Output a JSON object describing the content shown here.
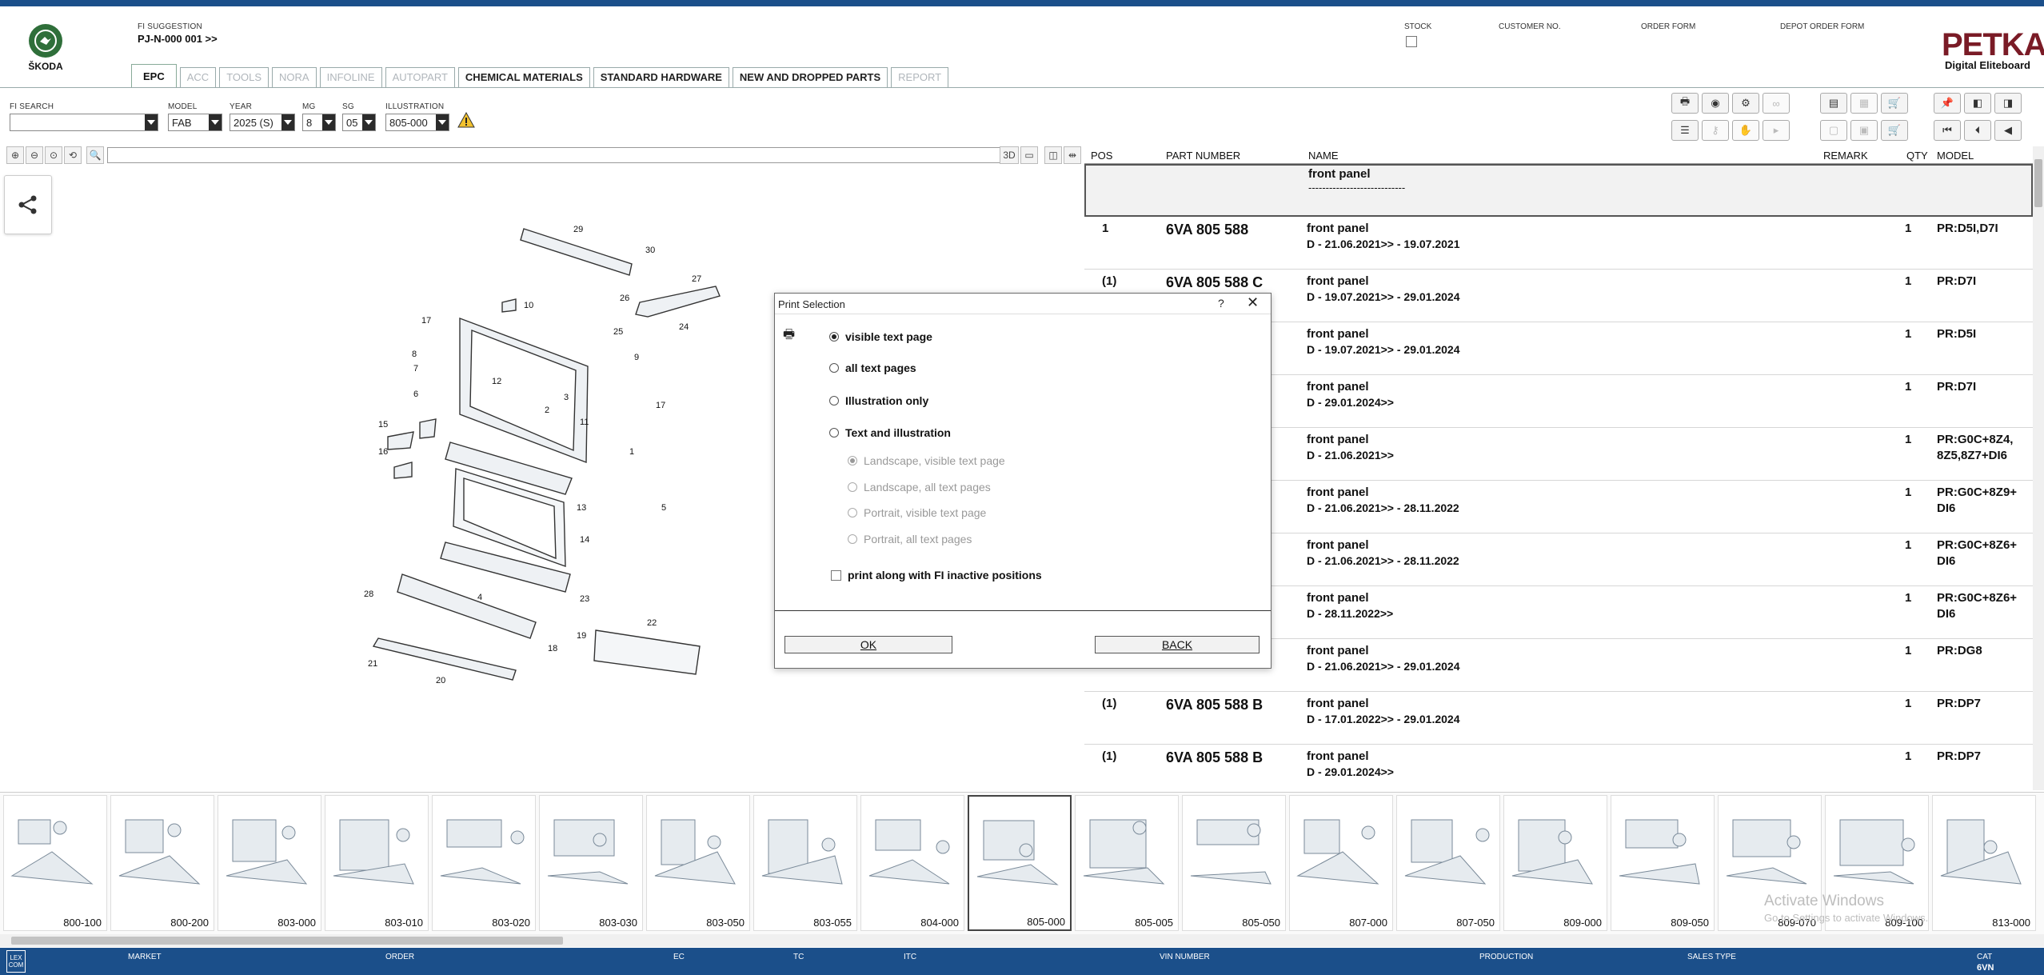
{
  "brand": {
    "logo_text": "ŠKODA",
    "petka_title": "PETKA",
    "petka_subtitle": "Digital Eliteboard"
  },
  "fi_suggestion": {
    "label": "FI SUGGESTION",
    "value": "PJ-N-000 001 >>"
  },
  "top_fields": {
    "stock": "STOCK",
    "customer_no": "CUSTOMER NO.",
    "order_form": "ORDER FORM",
    "depot_order_form": "DEPOT ORDER FORM"
  },
  "tabs": [
    {
      "label": "EPC",
      "state": "active"
    },
    {
      "label": "ACC",
      "state": "disabled"
    },
    {
      "label": "TOOLS",
      "state": "disabled"
    },
    {
      "label": "NORA",
      "state": "disabled"
    },
    {
      "label": "INFOLINE",
      "state": "disabled"
    },
    {
      "label": "AUTOPART",
      "state": "disabled"
    },
    {
      "label": "CHEMICAL MATERIALS",
      "state": "enabled"
    },
    {
      "label": "STANDARD HARDWARE",
      "state": "enabled"
    },
    {
      "label": "NEW AND DROPPED PARTS",
      "state": "enabled"
    },
    {
      "label": "REPORT",
      "state": "disabled"
    }
  ],
  "filters": {
    "fi_search": {
      "label": "FI SEARCH",
      "value": ""
    },
    "model": {
      "label": "MODEL",
      "value": "FAB"
    },
    "year": {
      "label": "YEAR",
      "value": "2025 (S)"
    },
    "mg": {
      "label": "MG",
      "value": "8"
    },
    "sg": {
      "label": "SG",
      "value": "05"
    },
    "illustration": {
      "label": "ILLUSTRATION",
      "value": "805-000"
    }
  },
  "table": {
    "headers": {
      "pos": "POS",
      "part_number": "PART NUMBER",
      "name": "NAME",
      "remark": "REMARK",
      "qty": "QTY",
      "model": "MODEL"
    },
    "group_header": {
      "name": "front panel",
      "sub": "----------------------------"
    },
    "rows": [
      {
        "pos": "1",
        "part": "6VA 805 588",
        "name": "front panel",
        "date": "D - 21.06.2021>> - 19.07.2021",
        "qty": "1",
        "model": "PR:D5I,D7I",
        "model2": ""
      },
      {
        "pos": "(1)",
        "part": "6VA 805 588 C",
        "name": "front panel",
        "date": "D - 19.07.2021>> - 29.01.2024",
        "qty": "1",
        "model": "PR:D7I",
        "model2": ""
      },
      {
        "pos": "",
        "part": "",
        "name": "front panel",
        "date": "D - 19.07.2021>> - 29.01.2024",
        "qty": "1",
        "model": "PR:D5I",
        "model2": ""
      },
      {
        "pos": "",
        "part": "",
        "name": "front panel",
        "date": "D - 29.01.2024>>",
        "qty": "1",
        "model": "PR:D7I",
        "model2": ""
      },
      {
        "pos": "",
        "part": "",
        "name": "front panel",
        "date": "D - 21.06.2021>>",
        "qty": "1",
        "model": "PR:G0C+8Z4,",
        "model2": "8Z5,8Z7+DI6"
      },
      {
        "pos": "",
        "part": "",
        "name": "front panel",
        "date": "D - 21.06.2021>> - 28.11.2022",
        "qty": "1",
        "model": "PR:G0C+8Z9+",
        "model2": "DI6"
      },
      {
        "pos": "",
        "part": "",
        "name": "front panel",
        "date": "D - 21.06.2021>> - 28.11.2022",
        "qty": "1",
        "model": "PR:G0C+8Z6+",
        "model2": "DI6"
      },
      {
        "pos": "",
        "part": "",
        "name": "front panel",
        "date": "D - 28.11.2022>>",
        "qty": "1",
        "model": "PR:G0C+8Z6+",
        "model2": "DI6"
      },
      {
        "pos": "",
        "part": "",
        "name": "front panel",
        "date": "D - 21.06.2021>> - 29.01.2024",
        "qty": "1",
        "model": "PR:DG8",
        "model2": ""
      },
      {
        "pos": "(1)",
        "part": "6VA 805 588 B",
        "name": "front panel",
        "date": "D - 17.01.2022>> - 29.01.2024",
        "qty": "1",
        "model": "PR:DP7",
        "model2": ""
      },
      {
        "pos": "(1)",
        "part": "6VA 805 588 B",
        "name": "front panel",
        "date": "D - 29.01.2024>>",
        "qty": "1",
        "model": "PR:DP7",
        "model2": ""
      }
    ]
  },
  "dialog": {
    "title": "Print Selection",
    "help": "?",
    "close": "✕",
    "options": {
      "visible_text_page": "visible text page",
      "all_text_pages": "all text pages",
      "illustration_only": "Illustration only",
      "text_and_illustration": "Text and illustration"
    },
    "sub_options": {
      "landscape_visible": "Landscape, visible text page",
      "landscape_all": "Landscape, all text pages",
      "portrait_visible": "Portrait, visible text page",
      "portrait_all": "Portrait, all text pages"
    },
    "checkbox_label": "print along with FI inactive positions",
    "ok": "OK",
    "back": "BACK"
  },
  "illustration_callouts": [
    "29",
    "30",
    "27",
    "26",
    "24",
    "25",
    "10",
    "17",
    "9",
    "8",
    "7",
    "12",
    "3",
    "2",
    "17",
    "6",
    "11",
    "15",
    "1",
    "16",
    "13",
    "5",
    "14",
    "28",
    "4",
    "23",
    "22",
    "19",
    "18",
    "21",
    "20"
  ],
  "thumbnails": [
    "800-100",
    "800-200",
    "803-000",
    "803-010",
    "803-020",
    "803-030",
    "803-050",
    "803-055",
    "804-000",
    "805-000",
    "805-005",
    "805-050",
    "807-000",
    "807-050",
    "809-000",
    "809-050",
    "809-070",
    "809-100",
    "813-000"
  ],
  "selected_thumbnail": "805-000",
  "watermark": {
    "line1": "Activate Windows",
    "line2": "Go to Settings to activate Windows."
  },
  "status_bar": {
    "market": "MARKET",
    "order": "ORDER",
    "ec": "EC",
    "tc": "TC",
    "itc": "ITC",
    "vin": "VIN NUMBER",
    "production": "PRODUCTION",
    "sales_type": "SALES TYPE",
    "cat": "CAT",
    "cat_value": "6VN",
    "lexcom": "LEX COM"
  },
  "zoom_bar": {
    "mode_3d": "3D"
  }
}
